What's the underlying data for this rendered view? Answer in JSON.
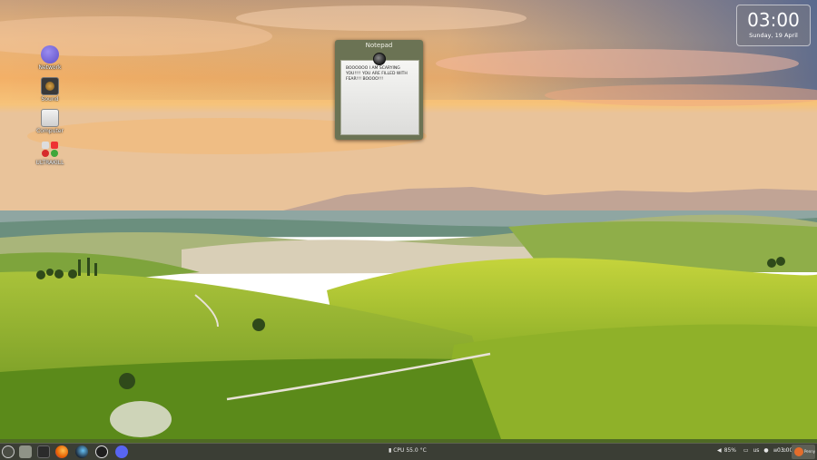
{
  "desktop": {
    "icons": [
      {
        "label": "Network",
        "icon": "network-icon"
      },
      {
        "label": "Sound",
        "icon": "speaker-icon"
      },
      {
        "label": "Computer",
        "icon": "computer-icon"
      },
      {
        "label": "ULTRAKILL",
        "icon": "ultrakill-icon"
      }
    ]
  },
  "notepad": {
    "title": "Notepad",
    "text": "BOOOOOO I AM SCARYING YOU!!!! YOU ARE FILLED WITH FEAR!!! BOOOO!!!"
  },
  "clock": {
    "time": "03:00",
    "date": "Sunday, 19 April"
  },
  "taskbar": {
    "apps": [
      "menu-icon",
      "files-icon",
      "terminal-icon",
      "firefox-icon",
      "steam-icon",
      "obs-icon",
      "discord-icon"
    ],
    "cpu_label": "CPU",
    "cpu_value": "55.0 °C",
    "volume": "85%",
    "keyboard_layout": "us",
    "time": "03:00",
    "user": "Penny"
  },
  "colors": {
    "taskbar_bg": "#3b3e35",
    "notepad_frame": "#6b7354",
    "firefox": "#e66000",
    "discord": "#5865f2",
    "steam": "#1b2838"
  }
}
